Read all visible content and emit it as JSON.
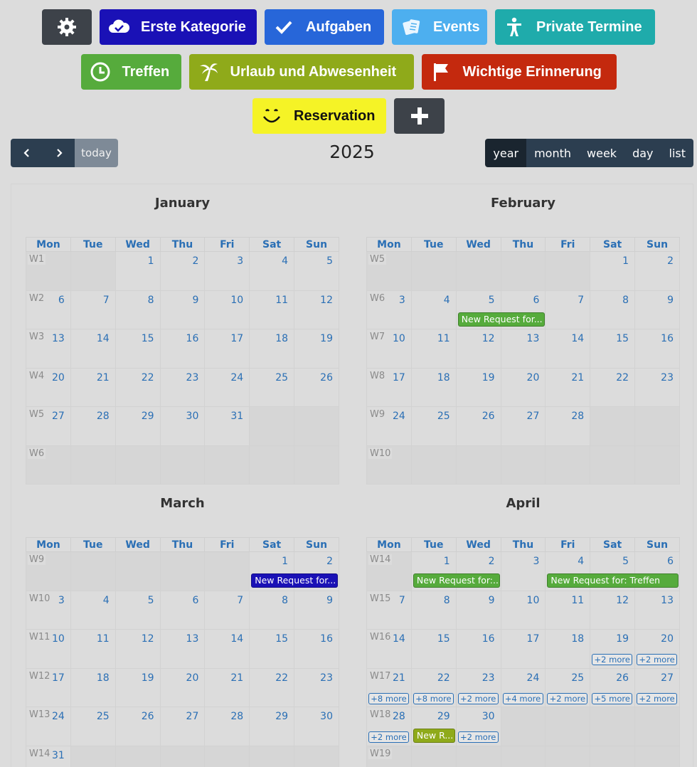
{
  "categories": {
    "row1": [
      {
        "id": "settings",
        "label": "",
        "icon": "gear-icon",
        "color": "#3d4249",
        "width": 70
      },
      {
        "id": "erste-kategorie",
        "label": "Erste Kategorie",
        "icon": "cloud-check-icon",
        "color": "#1a11b6",
        "width": 221
      },
      {
        "id": "aufgaben",
        "label": "Aufgaben",
        "icon": "check-icon",
        "color": "#2766d9",
        "width": 168
      },
      {
        "id": "events",
        "label": "Events",
        "icon": "tickets-icon",
        "color": "#4dafef",
        "width": 134
      },
      {
        "id": "private-termine",
        "label": "Private Termine",
        "icon": "person-icon",
        "color": "#1fabab",
        "width": 225
      }
    ],
    "row2": [
      {
        "id": "treffen",
        "label": "Treffen",
        "icon": "clock-icon",
        "color": "#56ab3c",
        "width": 141
      },
      {
        "id": "urlaub",
        "label": "Urlaub und Abwesenheit",
        "icon": "palm-tree-icon",
        "color": "#8faa1a",
        "width": 316
      },
      {
        "id": "wichtige-erinnerung",
        "label": "Wichtige Erinnerung",
        "icon": "flag-icon",
        "color": "#c4290e",
        "width": 274
      }
    ],
    "row3": [
      {
        "id": "reservation",
        "label": "Reservation",
        "icon": "smiley-icon",
        "color": "#f5f326",
        "text": "#111111",
        "width": 188
      },
      {
        "id": "add",
        "label": "",
        "icon": "plus-icon",
        "color": "#3d4249",
        "width": 71
      }
    ]
  },
  "toolbar": {
    "today_label": "today",
    "title": "2025",
    "views": [
      "year",
      "month",
      "week",
      "day",
      "list"
    ],
    "active_view": "year"
  },
  "weekdays": [
    "Mon",
    "Tue",
    "Wed",
    "Thu",
    "Fri",
    "Sat",
    "Sun"
  ],
  "months": [
    {
      "name": "January",
      "weeks": [
        {
          "wk": "W1",
          "days": [
            "",
            "1",
            "2",
            "3",
            "4",
            "5"
          ],
          "offset": 1
        },
        {
          "wk": "W2",
          "days": [
            "6",
            "7",
            "8",
            "9",
            "10",
            "11",
            "12"
          ],
          "offset": 0
        },
        {
          "wk": "W3",
          "days": [
            "13",
            "14",
            "15",
            "16",
            "17",
            "18",
            "19"
          ],
          "offset": 0
        },
        {
          "wk": "W4",
          "days": [
            "20",
            "21",
            "22",
            "23",
            "24",
            "25",
            "26"
          ],
          "offset": 0
        },
        {
          "wk": "W5",
          "days": [
            "27",
            "28",
            "29",
            "30",
            "31"
          ],
          "offset": 0
        },
        {
          "wk": "W6",
          "days": [],
          "offset": 0
        }
      ],
      "events": [],
      "more": []
    },
    {
      "name": "February",
      "weeks": [
        {
          "wk": "W5",
          "days": [
            "1",
            "2"
          ],
          "offset": 5
        },
        {
          "wk": "W6",
          "days": [
            "3",
            "4",
            "5",
            "6",
            "7",
            "8",
            "9"
          ],
          "offset": 0
        },
        {
          "wk": "W7",
          "days": [
            "10",
            "11",
            "12",
            "13",
            "14",
            "15",
            "16"
          ],
          "offset": 0
        },
        {
          "wk": "W8",
          "days": [
            "17",
            "18",
            "19",
            "20",
            "21",
            "22",
            "23"
          ],
          "offset": 0
        },
        {
          "wk": "W9",
          "days": [
            "24",
            "25",
            "26",
            "27",
            "28"
          ],
          "offset": 0
        },
        {
          "wk": "W10",
          "days": [],
          "offset": 0
        }
      ],
      "events": [
        {
          "week": 1,
          "col": 2,
          "span": 2,
          "label": "New Request for...",
          "color": "#56ab3c"
        }
      ],
      "more": []
    },
    {
      "name": "March",
      "weeks": [
        {
          "wk": "W9",
          "days": [
            "1",
            "2"
          ],
          "offset": 5
        },
        {
          "wk": "W10",
          "days": [
            "3",
            "4",
            "5",
            "6",
            "7",
            "8",
            "9"
          ],
          "offset": 0
        },
        {
          "wk": "W11",
          "days": [
            "10",
            "11",
            "12",
            "13",
            "14",
            "15",
            "16"
          ],
          "offset": 0
        },
        {
          "wk": "W12",
          "days": [
            "17",
            "18",
            "19",
            "20",
            "21",
            "22",
            "23"
          ],
          "offset": 0
        },
        {
          "wk": "W13",
          "days": [
            "24",
            "25",
            "26",
            "27",
            "28",
            "29",
            "30"
          ],
          "offset": 0
        },
        {
          "wk": "W14",
          "days": [
            "31"
          ],
          "offset": 0
        }
      ],
      "events": [
        {
          "week": 0,
          "col": 5,
          "span": 2,
          "label": "New Request for...",
          "color": "#1a11b6"
        }
      ],
      "more": []
    },
    {
      "name": "April",
      "weeks": [
        {
          "wk": "W14",
          "days": [
            "1",
            "2",
            "3",
            "4",
            "5",
            "6"
          ],
          "offset": 1
        },
        {
          "wk": "W15",
          "days": [
            "7",
            "8",
            "9",
            "10",
            "11",
            "12",
            "13"
          ],
          "offset": 0
        },
        {
          "wk": "W16",
          "days": [
            "14",
            "15",
            "16",
            "17",
            "18",
            "19",
            "20"
          ],
          "offset": 0
        },
        {
          "wk": "W17",
          "days": [
            "21",
            "22",
            "23",
            "24",
            "25",
            "26",
            "27"
          ],
          "offset": 0
        },
        {
          "wk": "W18",
          "days": [
            "28",
            "29",
            "30"
          ],
          "offset": 0
        },
        {
          "wk": "W19",
          "days": [],
          "offset": 0
        }
      ],
      "events": [
        {
          "week": 0,
          "col": 1,
          "span": 2,
          "label": "New Request for:...",
          "color": "#56ab3c"
        },
        {
          "week": 0,
          "col": 4,
          "span": 3,
          "label": "New Request for: Treffen",
          "color": "#56ab3c"
        },
        {
          "week": 4,
          "col": 1,
          "span": 1,
          "label": "New R...",
          "color": "#8faa1a"
        }
      ],
      "more": [
        {
          "week": 2,
          "col": 5,
          "label": "+2 more"
        },
        {
          "week": 2,
          "col": 6,
          "label": "+2 more"
        },
        {
          "week": 3,
          "col": 0,
          "label": "+8 more"
        },
        {
          "week": 3,
          "col": 1,
          "label": "+8 more"
        },
        {
          "week": 3,
          "col": 2,
          "label": "+2 more"
        },
        {
          "week": 3,
          "col": 3,
          "label": "+4 more"
        },
        {
          "week": 3,
          "col": 4,
          "label": "+2 more"
        },
        {
          "week": 3,
          "col": 5,
          "label": "+5 more"
        },
        {
          "week": 3,
          "col": 6,
          "label": "+2 more"
        },
        {
          "week": 4,
          "col": 0,
          "label": "+2 more"
        },
        {
          "week": 4,
          "col": 2,
          "label": "+2 more"
        }
      ]
    }
  ]
}
